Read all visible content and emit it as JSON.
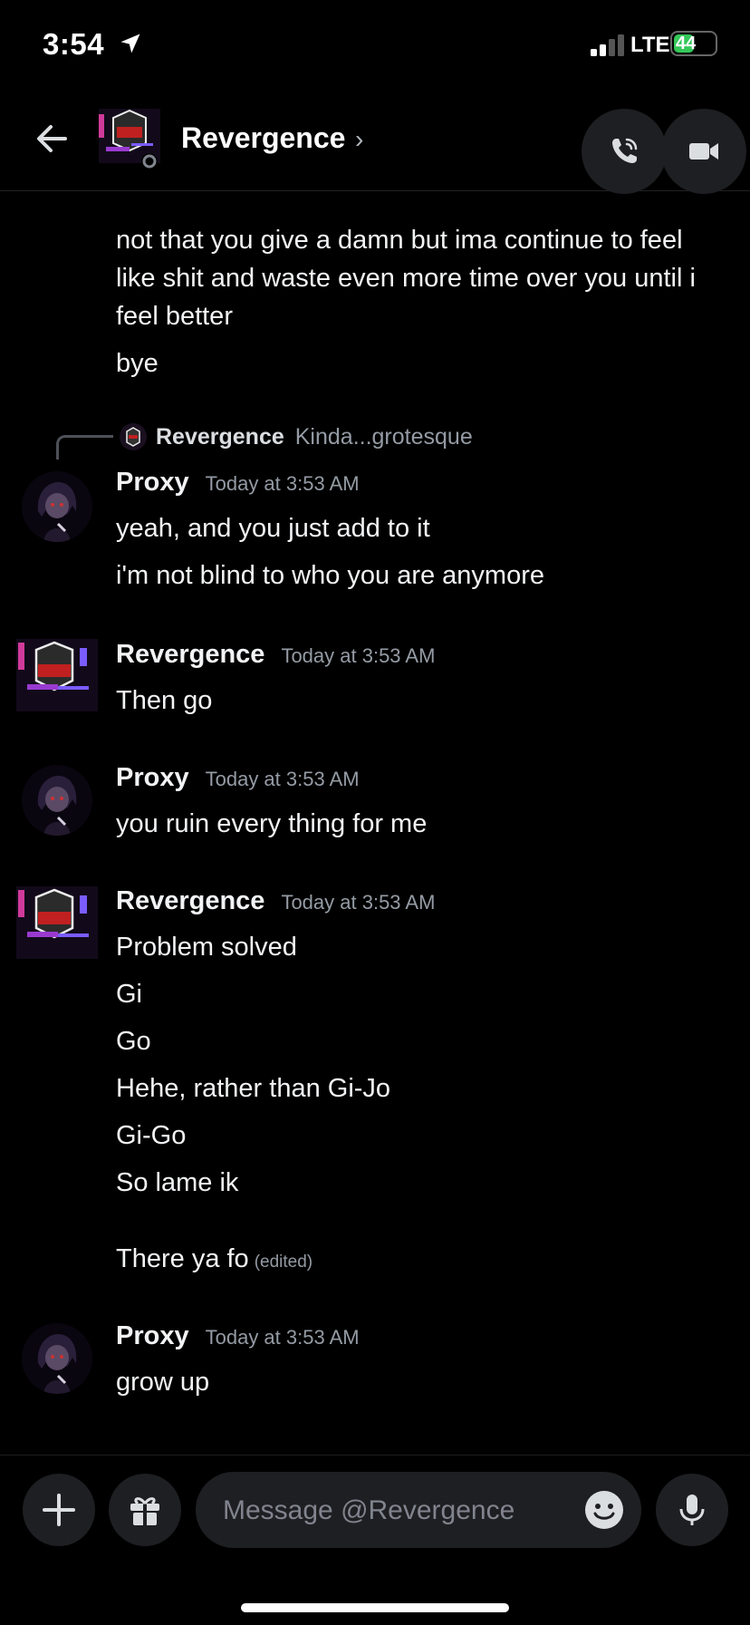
{
  "status_bar": {
    "time": "3:54",
    "network": "LTE",
    "battery": "44"
  },
  "header": {
    "title": "Revergence",
    "chevron": "›"
  },
  "messages": {
    "m1_line1": "not that you give a damn but ima continue to feel",
    "m1_line2": "like shit and waste even more time over you until i",
    "m1_line3": "feel better",
    "m2": "bye",
    "reply_name": "Revergence",
    "reply_text": "Kinda...grotesque",
    "g1_author": "Proxy",
    "g1_time": "Today at 3:53 AM",
    "g1_l1": "yeah, and you just add to it",
    "g1_l2": "i'm not blind to who you are anymore",
    "g2_author": "Revergence",
    "g2_time": "Today at 3:53 AM",
    "g2_l1": "Then go",
    "g3_author": "Proxy",
    "g3_time": "Today at 3:53 AM",
    "g3_l1": "you ruin every thing for me",
    "g4_author": "Revergence",
    "g4_time": "Today at 3:53 AM",
    "g4_l1": "Problem solved",
    "g4_l2": "Gi",
    "g4_l3": "Go",
    "g4_l4": "Hehe, rather than Gi-Jo",
    "g4_l5": "Gi-Go",
    "g4_l6": "So lame ik",
    "g4_l7": "There ya fo",
    "g4_edited": "(edited)",
    "g5_author": "Proxy",
    "g5_time": "Today at 3:53 AM",
    "g5_l1": "grow up"
  },
  "composer": {
    "placeholder": "Message @Revergence"
  },
  "colors": {
    "background": "#000000",
    "input_bg": "#1e1f22",
    "muted": "#949ba4",
    "battery": "#34c759"
  },
  "icons": [
    "location-arrow-icon",
    "signal-icon",
    "battery-icon",
    "back-arrow-icon",
    "phone-icon",
    "video-camera-icon",
    "plus-icon",
    "gift-icon",
    "emoji-icon",
    "microphone-icon"
  ]
}
